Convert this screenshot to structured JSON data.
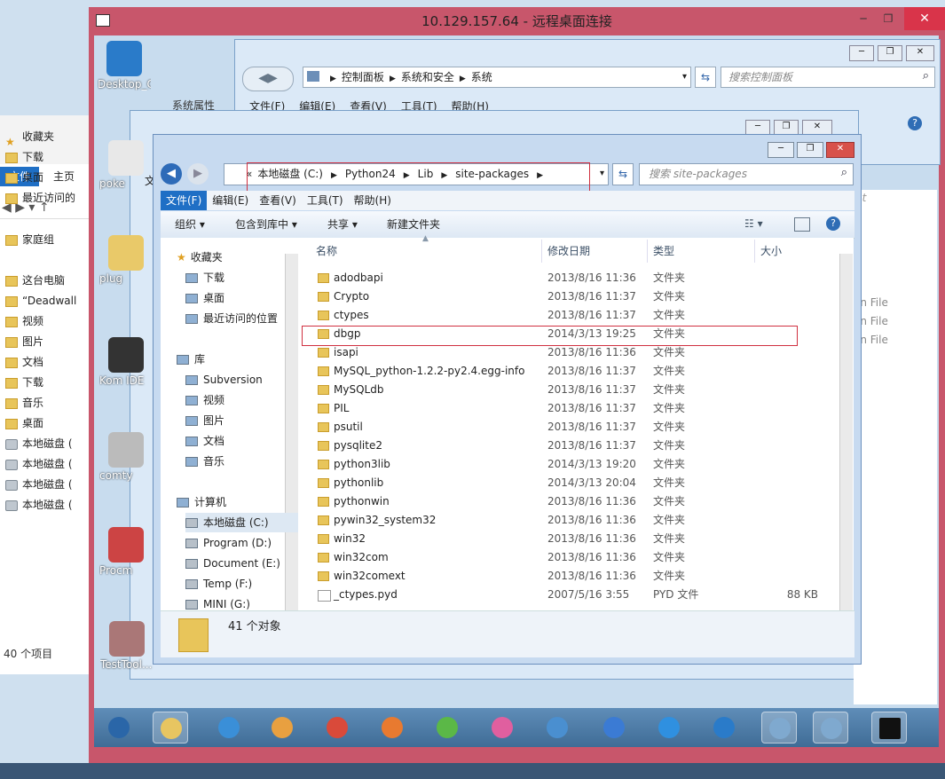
{
  "rdp": {
    "title": "10.129.157.64 - 远程桌面连接",
    "min": "─",
    "restore": "❐",
    "close": "✕"
  },
  "host_explorer": {
    "tabs": [
      "文件",
      "主页"
    ],
    "items": [
      {
        "label": "收藏夹",
        "icon": "star-icon"
      },
      {
        "label": "下载",
        "icon": "folder-icon"
      },
      {
        "label": "桌面",
        "icon": "desktop-icon"
      },
      {
        "label": "最近访问的",
        "icon": "recent-icon"
      },
      {
        "label": "家庭组",
        "icon": "homegroup-icon"
      },
      {
        "label": "这台电脑",
        "icon": "computer-icon"
      },
      {
        "label": "“Deadwall",
        "icon": "file-icon"
      },
      {
        "label": "视频",
        "icon": "folder-icon"
      },
      {
        "label": "图片",
        "icon": "folder-icon"
      },
      {
        "label": "文档",
        "icon": "folder-icon"
      },
      {
        "label": "下载",
        "icon": "folder-icon"
      },
      {
        "label": "音乐",
        "icon": "folder-icon"
      },
      {
        "label": "桌面",
        "icon": "folder-icon"
      },
      {
        "label": "本地磁盘 (",
        "icon": "drive-icon"
      },
      {
        "label": "本地磁盘 (",
        "icon": "drive-icon"
      },
      {
        "label": "本地磁盘 (",
        "icon": "drive-icon"
      },
      {
        "label": "本地磁盘 (",
        "icon": "drive-icon"
      }
    ],
    "status": "40 个项目"
  },
  "desktop_icons": [
    {
      "label": "Desktop_C...",
      "icon": "sogou-icon"
    },
    {
      "label": "poke",
      "icon": "app-icon"
    },
    {
      "label": "plug",
      "icon": "folder-icon"
    },
    {
      "label": "Kom IDE",
      "icon": "ide-icon"
    },
    {
      "label": "comty",
      "icon": "app-icon"
    },
    {
      "label": "Procm",
      "icon": "app-icon"
    },
    {
      "label": "TestTool...",
      "icon": "app-icon"
    }
  ],
  "control_panel": {
    "breadcrumb": [
      "控制面板",
      "系统和安全",
      "系统"
    ],
    "search_placeholder": "搜索控制面板",
    "menu": [
      "文件(F)",
      "编辑(E)",
      "查看(V)",
      "工具(T)",
      "帮助(H)"
    ],
    "side_text": "系统属性",
    "mid_text": "文"
  },
  "explorer": {
    "breadcrumb": [
      "本地磁盘 (C:)",
      "Python24",
      "Lib",
      "site-packages"
    ],
    "search_placeholder": "搜索 site-packages",
    "menu": [
      "文件(F)",
      "编辑(E)",
      "查看(V)",
      "工具(T)",
      "帮助(H)"
    ],
    "toolbar": [
      "组织 ▾",
      "包含到库中 ▾",
      "共享 ▾",
      "新建文件夹"
    ],
    "nav": [
      {
        "label": "收藏夹",
        "icon": "star-icon",
        "level": 0
      },
      {
        "label": "下载",
        "icon": "download-folder-icon",
        "level": 1
      },
      {
        "label": "桌面",
        "icon": "desktop-icon",
        "level": 1
      },
      {
        "label": "最近访问的位置",
        "icon": "recent-icon",
        "level": 1
      },
      {
        "label": "",
        "icon": "",
        "level": 0
      },
      {
        "label": "库",
        "icon": "library-icon",
        "level": 0
      },
      {
        "label": "Subversion",
        "icon": "library-item-icon",
        "level": 1
      },
      {
        "label": "视频",
        "icon": "video-icon",
        "level": 1
      },
      {
        "label": "图片",
        "icon": "picture-icon",
        "level": 1
      },
      {
        "label": "文档",
        "icon": "document-icon",
        "level": 1
      },
      {
        "label": "音乐",
        "icon": "music-icon",
        "level": 1
      },
      {
        "label": "",
        "icon": "",
        "level": 0
      },
      {
        "label": "计算机",
        "icon": "computer-icon",
        "level": 0
      },
      {
        "label": "本地磁盘 (C:)",
        "icon": "drive-icon",
        "level": 1
      },
      {
        "label": "Program (D:)",
        "icon": "drive-icon",
        "level": 1
      },
      {
        "label": "Document (E:)",
        "icon": "drive-icon",
        "level": 1
      },
      {
        "label": "Temp (F:)",
        "icon": "drive-icon",
        "level": 1
      },
      {
        "label": "MINI (G:)",
        "icon": "drive-icon",
        "level": 1
      }
    ],
    "columns": [
      "名称",
      "修改日期",
      "类型",
      "大小"
    ],
    "rows": [
      {
        "name": "adodbapi",
        "date": "2013/8/16 11:36",
        "type": "文件夹",
        "size": ""
      },
      {
        "name": "Crypto",
        "date": "2013/8/16 11:37",
        "type": "文件夹",
        "size": ""
      },
      {
        "name": "ctypes",
        "date": "2013/8/16 11:37",
        "type": "文件夹",
        "size": ""
      },
      {
        "name": "dbgp",
        "date": "2014/3/13 19:25",
        "type": "文件夹",
        "size": ""
      },
      {
        "name": "isapi",
        "date": "2013/8/16 11:36",
        "type": "文件夹",
        "size": ""
      },
      {
        "name": "MySQL_python-1.2.2-py2.4.egg-info",
        "date": "2013/8/16 11:37",
        "type": "文件夹",
        "size": ""
      },
      {
        "name": "MySQLdb",
        "date": "2013/8/16 11:37",
        "type": "文件夹",
        "size": ""
      },
      {
        "name": "PIL",
        "date": "2013/8/16 11:37",
        "type": "文件夹",
        "size": ""
      },
      {
        "name": "psutil",
        "date": "2013/8/16 11:37",
        "type": "文件夹",
        "size": ""
      },
      {
        "name": "pysqlite2",
        "date": "2013/8/16 11:37",
        "type": "文件夹",
        "size": ""
      },
      {
        "name": "python3lib",
        "date": "2014/3/13 19:20",
        "type": "文件夹",
        "size": ""
      },
      {
        "name": "pythonlib",
        "date": "2014/3/13 20:04",
        "type": "文件夹",
        "size": ""
      },
      {
        "name": "pythonwin",
        "date": "2013/8/16 11:36",
        "type": "文件夹",
        "size": ""
      },
      {
        "name": "pywin32_system32",
        "date": "2013/8/16 11:36",
        "type": "文件夹",
        "size": ""
      },
      {
        "name": "win32",
        "date": "2013/8/16 11:36",
        "type": "文件夹",
        "size": ""
      },
      {
        "name": "win32com",
        "date": "2013/8/16 11:36",
        "type": "文件夹",
        "size": ""
      },
      {
        "name": "win32comext",
        "date": "2013/8/16 11:36",
        "type": "文件夹",
        "size": ""
      },
      {
        "name": "_ctypes.pyd",
        "date": "2007/5/16 3:55",
        "type": "PYD 文件",
        "size": "88 KB"
      }
    ],
    "status": "41 个对象"
  },
  "right_fragments": [
    "on File",
    "on File",
    "on File",
    "nt"
  ],
  "taskbar_icons": [
    "start-icon",
    "explorer-icon",
    "ie-icon",
    "media-icon",
    "chrome-icon",
    "app-icon",
    "360-icon",
    "pinwheel-icon",
    "globe-icon",
    "app-icon",
    "app-icon",
    "sogou-icon",
    "network-icon",
    "monitor-icon",
    "cmd-icon"
  ],
  "colors": {
    "rdp_accent": "#c8566b",
    "highlight_box": "#d03040",
    "selection": "#cce4f7"
  }
}
